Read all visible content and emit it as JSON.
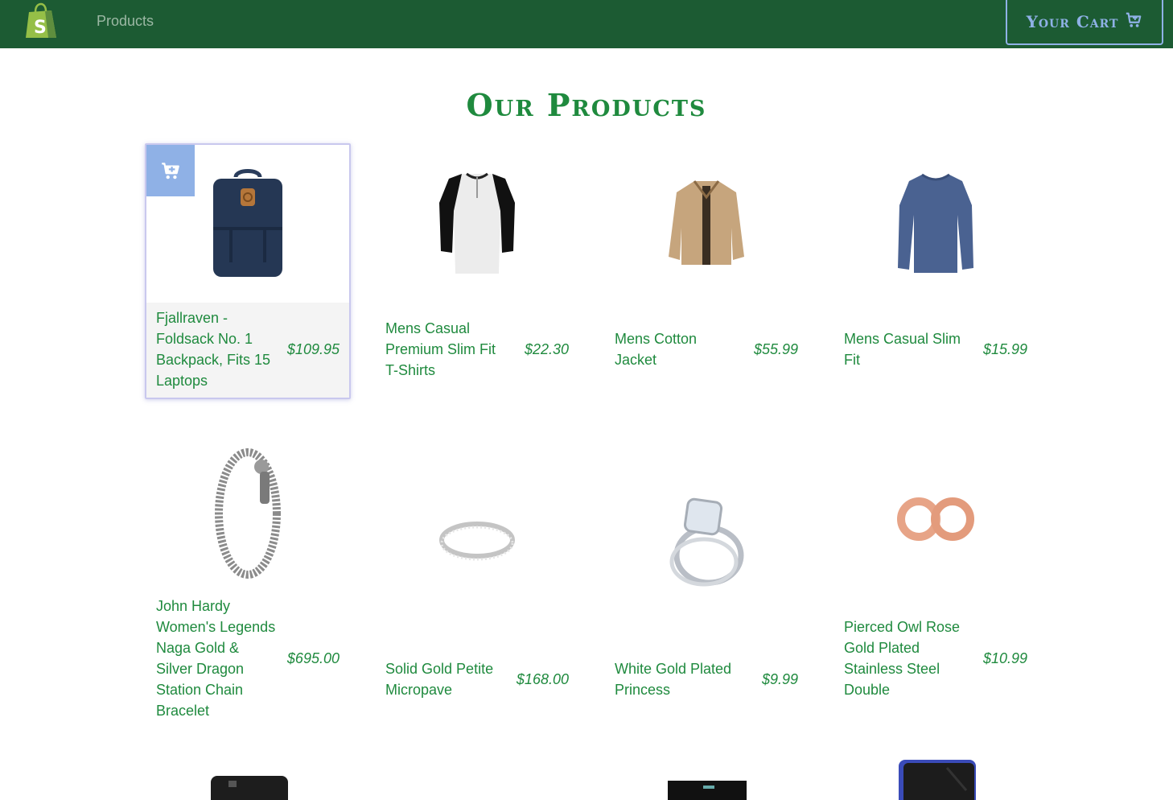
{
  "nav": {
    "brand": "shopify-bag",
    "link_label": "Products",
    "cart_label": "Your Cart",
    "colors": {
      "bar": "#1c5b33",
      "link": "#9cb8a4",
      "cart": "#8fb1e6",
      "accent": "#1f8a3e"
    }
  },
  "page": {
    "title": "Our Products"
  },
  "products": [
    {
      "name": "Fjallraven - Foldsack No. 1 Backpack, Fits 15 Laptops",
      "price": "$109.95",
      "icon": "backpack"
    },
    {
      "name": "Mens Casual Premium Slim Fit T-Shirts",
      "price": "$22.30",
      "icon": "raglan-shirt"
    },
    {
      "name": "Mens Cotton Jacket",
      "price": "$55.99",
      "icon": "jacket"
    },
    {
      "name": "Mens Casual Slim Fit",
      "price": "$15.99",
      "icon": "long-sleeve-shirt"
    },
    {
      "name": "John Hardy Women's Legends Naga Gold & Silver Dragon Station Chain Bracelet",
      "price": "$695.00",
      "icon": "bracelet"
    },
    {
      "name": "Solid Gold Petite Micropave",
      "price": "$168.00",
      "icon": "ring-band"
    },
    {
      "name": "White Gold Plated Princess",
      "price": "$9.99",
      "icon": "diamond-ring"
    },
    {
      "name": "Pierced Owl Rose Gold Plated Stainless Steel Double",
      "price": "$10.99",
      "icon": "rose-gold-plugs"
    },
    {
      "name": "",
      "price": "",
      "icon": "hard-drive"
    },
    {
      "name": "",
      "price": "",
      "icon": ""
    },
    {
      "name": "",
      "price": "",
      "icon": "ssd"
    },
    {
      "name": "",
      "price": "",
      "icon": "hard-drive-blue"
    }
  ]
}
